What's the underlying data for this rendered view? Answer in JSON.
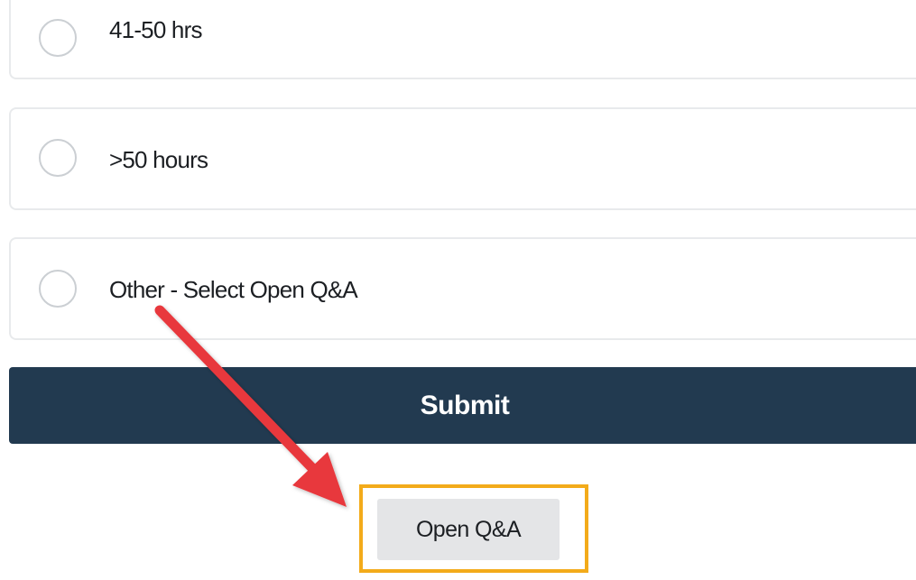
{
  "options": [
    {
      "label": "41-50 hrs",
      "selected": false
    },
    {
      "label": ">50 hours",
      "selected": false
    },
    {
      "label": "Other - Select Open Q&A",
      "selected": false
    }
  ],
  "submit": {
    "label": "Submit",
    "color": "#223a50"
  },
  "open_qa": {
    "label": "Open Q&A"
  },
  "annotation": {
    "arrow_color": "#e8383c",
    "highlight_color": "#f3ab1a"
  }
}
